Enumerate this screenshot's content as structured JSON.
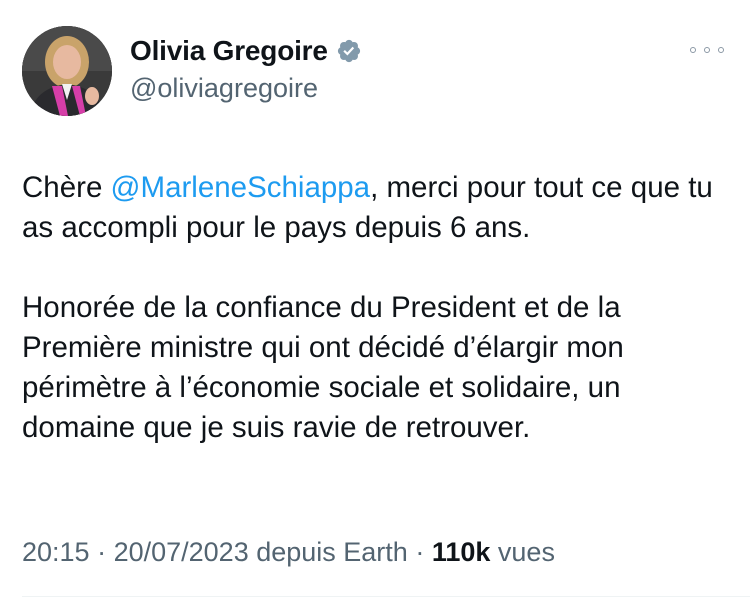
{
  "author": {
    "display_name": "Olivia Gregoire",
    "handle": "@oliviagregoire",
    "verified_icon": "verified-badge-icon",
    "avatar_icon": "profile-photo"
  },
  "menu": {
    "icon": "more-options-icon"
  },
  "tweet": {
    "p1_before": "Chère ",
    "mention": "@MarleneSchiappa",
    "p1_after": ", merci pour tout ce que tu as accompli pour le pays depuis 6 ans.",
    "p2": "Honorée de la confiance du President et de la Première ministre qui ont décidé d’élargir mon périmètre à l’économie sociale et solidaire, un domaine que je suis ravie de retrouver."
  },
  "meta": {
    "time": "20:15",
    "sep1": " · ",
    "date": "20/07/2023",
    "source": " depuis Earth",
    "sep2": " · ",
    "views_count": "110k",
    "views_label": " vues"
  },
  "colors": {
    "text": "#0f1419",
    "secondary": "#536471",
    "link": "#1d9bf0",
    "verified": "#829aab"
  }
}
